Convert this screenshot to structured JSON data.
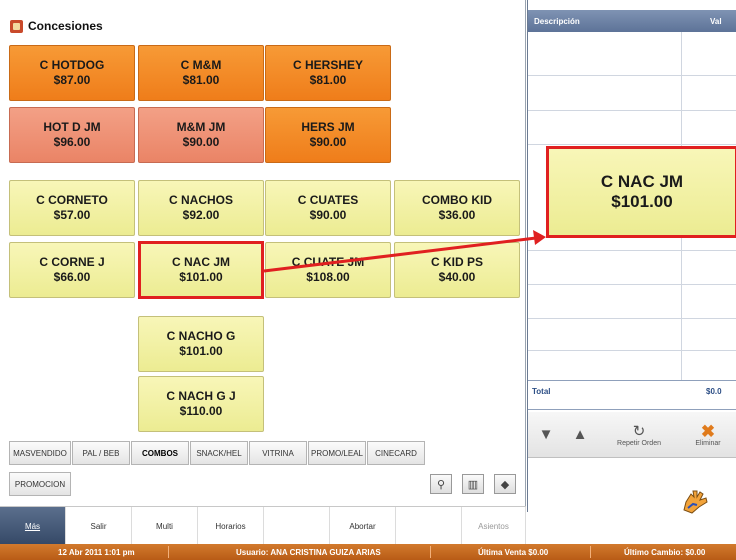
{
  "window": {
    "title": "Concesiones"
  },
  "products": {
    "hotdog": {
      "name": "C HOTDOG",
      "price": "$87.00"
    },
    "mm": {
      "name": "C M&M",
      "price": "$81.00"
    },
    "hershey": {
      "name": "C HERSHEY",
      "price": "$81.00"
    },
    "hotdjm": {
      "name": "HOT D JM",
      "price": "$96.00"
    },
    "mmjm": {
      "name": "M&M JM",
      "price": "$90.00"
    },
    "hersjm": {
      "name": "HERS JM",
      "price": "$90.00"
    },
    "corneto": {
      "name": "C CORNETO",
      "price": "$57.00"
    },
    "nachos": {
      "name": "C NACHOS",
      "price": "$92.00"
    },
    "cuates": {
      "name": "C CUATES",
      "price": "$90.00"
    },
    "combokid": {
      "name": "COMBO KID",
      "price": "$36.00"
    },
    "cornej": {
      "name": "C CORNE J",
      "price": "$66.00"
    },
    "nacjm": {
      "name": "C NAC JM",
      "price": "$101.00"
    },
    "cuatejm": {
      "name": "C CUATE JM",
      "price": "$108.00"
    },
    "kidps": {
      "name": "C KID PS",
      "price": "$40.00"
    },
    "nachog": {
      "name": "C NACHO G",
      "price": "$101.00"
    },
    "nachgj": {
      "name": "C NACH G J",
      "price": "$110.00"
    }
  },
  "categories": {
    "masvendido": "MASVENDIDO",
    "palbeb": "PAL / BEB",
    "combos": "COMBOS",
    "snackhel": "SNACK/HEL",
    "vitrina": "VITRINA",
    "promoleal": "PROMO/LEAL",
    "cinecard": "CINECARD",
    "promocion": "PROMOCION",
    "active": "COMBOS"
  },
  "nav": {
    "mas": "Más",
    "salir": "Salir",
    "multi": "Multi",
    "horarios": "Horarios",
    "abortar": "Abortar",
    "asientos": "Asientos"
  },
  "order_grid": {
    "col_description": "Descripción",
    "col_value": "Val",
    "total_label": "Total",
    "total_value": "$0.0"
  },
  "zoom": {
    "name": "C NAC JM",
    "price": "$101.00"
  },
  "actions": {
    "repeat": "Repetir Orden",
    "delete": "Eliminar"
  },
  "status": {
    "datetime": "12 Abr 2011 1:01 pm",
    "user": "Usuario: ANA CRISTINA GUIZA ARIAS",
    "last_sale": "Última Venta $0.00",
    "last_change": "Último Cambio: $0.00"
  },
  "colors": {
    "orange_tile": "#f08220",
    "salmon_tile": "#ee8c6e",
    "yellow_tile": "#f2f0a6",
    "highlight": "#e02020",
    "status_bar": "#c86a22",
    "header": "#6f84a8"
  },
  "icons": [
    "binoculars-icon",
    "film-icon",
    "cube-icon",
    "up-arrow-icon",
    "down-arrow-icon",
    "repeat-icon",
    "delete-x-icon",
    "hand-icon"
  ]
}
